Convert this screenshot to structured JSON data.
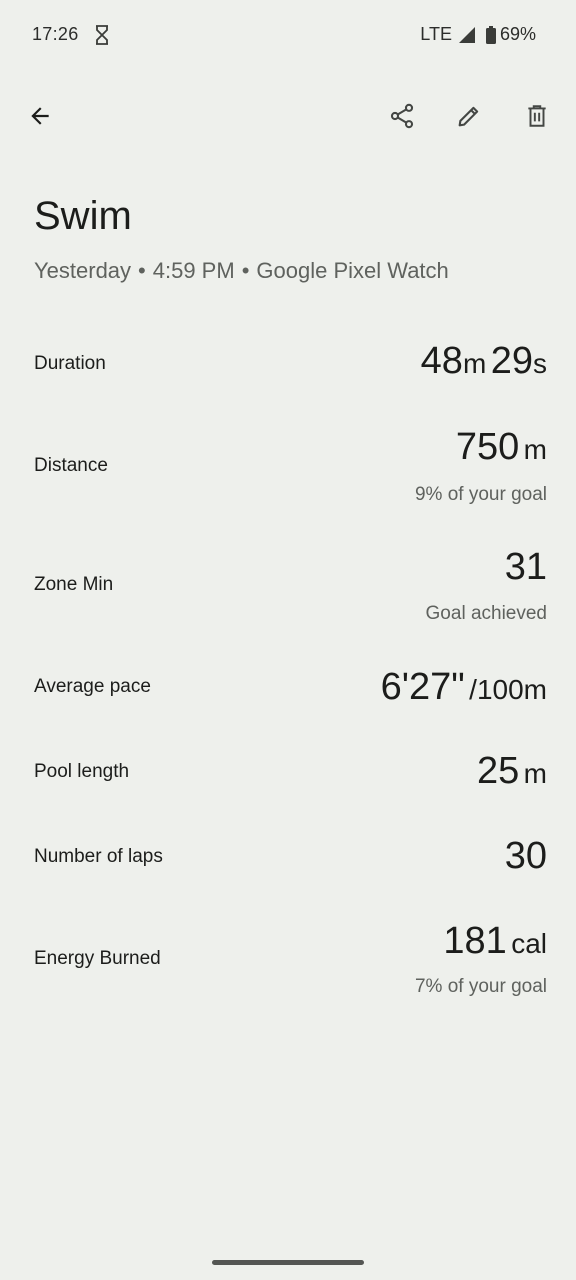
{
  "status_bar": {
    "time": "17:26",
    "network": "LTE",
    "battery": "69%",
    "icons": [
      "hourglass-icon",
      "signal-icon",
      "battery-icon"
    ]
  },
  "toolbar": {
    "icons": [
      "back-arrow-icon",
      "share-icon",
      "edit-icon",
      "delete-icon"
    ]
  },
  "header": {
    "title": "Swim",
    "day": "Yesterday",
    "time": "4:59 PM",
    "device": "Google Pixel Watch",
    "separator": "•"
  },
  "stats": {
    "duration": {
      "label": "Duration",
      "minutes": "48",
      "minutes_unit": "m",
      "seconds": "29",
      "seconds_unit": "s"
    },
    "distance": {
      "label": "Distance",
      "value": "750",
      "unit": "m",
      "note": "9% of your goal"
    },
    "zone_min": {
      "label": "Zone Min",
      "value": "31",
      "note": "Goal achieved"
    },
    "average_pace": {
      "label": "Average pace",
      "value": "6'27\"",
      "unit": "/100m"
    },
    "pool_length": {
      "label": "Pool length",
      "value": "25",
      "unit": "m"
    },
    "laps": {
      "label": "Number of laps",
      "value": "30"
    },
    "energy": {
      "label": "Energy Burned",
      "value": "181",
      "unit": "cal",
      "note": "7% of your goal"
    }
  },
  "colors": {
    "background": "#eef0ec",
    "text": "#1c1d1b",
    "secondary_text": "#5f625e",
    "icon": "#444744"
  }
}
